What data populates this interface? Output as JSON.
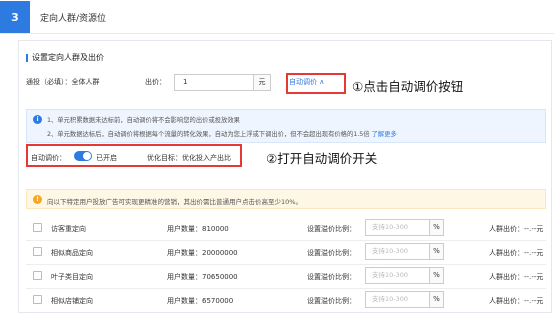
{
  "header": {
    "step": "3",
    "title": "定向人群/资源位"
  },
  "section": {
    "title": "设置定向人群及出价"
  },
  "bid_row": {
    "targeting_label": "通投（必填）：全体人群",
    "bid_label": "出价：",
    "bid_value": "1",
    "unit": "元",
    "auto_link": "自动调价 ∧"
  },
  "annotations": {
    "a1": "①点击自动调价按钮",
    "a2": "②打开自动调价开关"
  },
  "info": {
    "icon": "info-icon",
    "line1": "1、单元积累数据未达标前，自动调价将不会影响您的出价或投放效果",
    "line2": "2、单元数据达标后，自动调价将根据每个流量的转化效果，自动为您上浮或下调出价，但不会超出现有价格的1.5倍",
    "learn_more": "了解更多"
  },
  "auto": {
    "label": "自动调价：",
    "state": "已开启",
    "enabled": true,
    "goal": "优化目标：优化投入产出比"
  },
  "warning": {
    "icon": "warning-icon",
    "text": "向以下特定用户投放广告可实现更精准的营销，其出价需比普通用户点击价高至少10%。"
  },
  "table": {
    "rows": [
      {
        "name": "访客重定向",
        "users": "用户数量：810000",
        "premium_label": "设置溢价比例：",
        "placeholder": "支持10-300",
        "pct": "%",
        "avg": "人群出价：--.--元"
      },
      {
        "name": "相似商品定向",
        "users": "用户数量：20000000",
        "premium_label": "设置溢价比例：",
        "placeholder": "支持10-300",
        "pct": "%",
        "avg": "人群出价：--.--元"
      },
      {
        "name": "叶子类目定向",
        "users": "用户数量：70650000",
        "premium_label": "设置溢价比例：",
        "placeholder": "支持10-300",
        "pct": "%",
        "avg": "人群出价：--.--元"
      },
      {
        "name": "相似店铺定向",
        "users": "用户数量：6570000",
        "premium_label": "设置溢价比例：",
        "placeholder": "支持10-300",
        "pct": "%",
        "avg": "人群出价：--.--元"
      }
    ]
  },
  "colors": {
    "accent": "#2d7ae0",
    "highlight": "#e53935",
    "info_bg": "#eef5ff",
    "warn_bg": "#fff7e6"
  }
}
